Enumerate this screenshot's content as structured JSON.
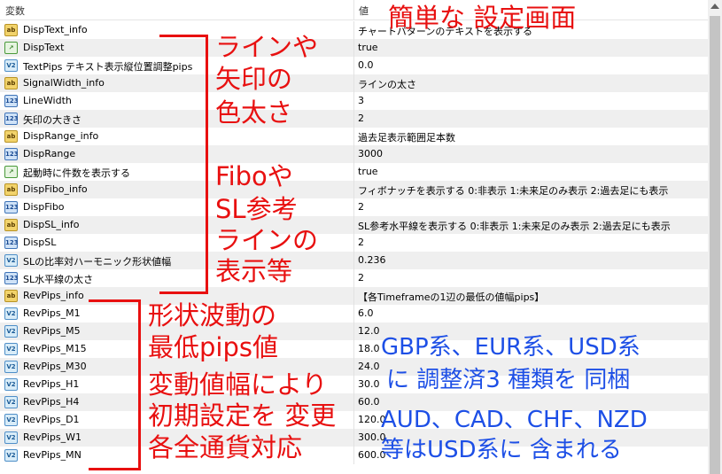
{
  "header": {
    "col_name": "変数",
    "col_value": "値"
  },
  "rows": [
    {
      "icon": "ab",
      "name": "DispText_info",
      "value": "チャートパターンのテキストを表示する"
    },
    {
      "icon": "bool",
      "name": "DispText",
      "value": "true"
    },
    {
      "icon": "v2",
      "name": "TextPips テキスト表示縦位置調整pips",
      "value": "0.0"
    },
    {
      "icon": "ab",
      "name": "SignalWidth_info",
      "value": "ラインの太さ"
    },
    {
      "icon": "n123",
      "name": "LineWidth",
      "value": "3"
    },
    {
      "icon": "n123",
      "name": "矢印の大きさ",
      "value": "2"
    },
    {
      "icon": "ab",
      "name": "DispRange_info",
      "value": "過去足表示範囲足本数"
    },
    {
      "icon": "n123",
      "name": "DispRange",
      "value": "3000"
    },
    {
      "icon": "bool",
      "name": "起動時に件数を表示する",
      "value": "true"
    },
    {
      "icon": "ab",
      "name": "DispFibo_info",
      "value": "フィボナッチを表示する 0:非表示 1:未来足のみ表示 2:過去足にも表示"
    },
    {
      "icon": "n123",
      "name": "DispFibo",
      "value": "2"
    },
    {
      "icon": "ab",
      "name": "DispSL_info",
      "value": "SL参考水平線を表示する 0:非表示 1:未来足のみ表示 2:過去足にも表示"
    },
    {
      "icon": "n123",
      "name": "DispSL",
      "value": "2"
    },
    {
      "icon": "v2",
      "name": "SLの比率対ハーモニック形状値幅",
      "value": "0.236"
    },
    {
      "icon": "n123",
      "name": "SL水平線の太さ",
      "value": "2"
    },
    {
      "icon": "ab",
      "name": "RevPips_info",
      "value": "【各Timeframeの1辺の最低の値幅pips】"
    },
    {
      "icon": "v2",
      "name": "RevPips_M1",
      "value": "6.0"
    },
    {
      "icon": "v2",
      "name": "RevPips_M5",
      "value": "12.0"
    },
    {
      "icon": "v2",
      "name": "RevPips_M15",
      "value": "18.0"
    },
    {
      "icon": "v2",
      "name": "RevPips_M30",
      "value": "24.0"
    },
    {
      "icon": "v2",
      "name": "RevPips_H1",
      "value": "30.0"
    },
    {
      "icon": "v2",
      "name": "RevPips_H4",
      "value": "60.0"
    },
    {
      "icon": "v2",
      "name": "RevPips_D1",
      "value": "120.0"
    },
    {
      "icon": "v2",
      "name": "RevPips_W1",
      "value": "300.0"
    },
    {
      "icon": "v2",
      "name": "RevPips_MN",
      "value": "600.0"
    }
  ],
  "annotations": {
    "title": "簡単な 設定画面",
    "group1": [
      "ラインや",
      "矢印の",
      "色太さ"
    ],
    "group2": [
      "Fiboや",
      "SL参考",
      "ラインの",
      "表示等"
    ],
    "group3": [
      "形状波動の",
      "最低pips値",
      "変動値幅により",
      "初期設定を 変更",
      "各全通貨対応"
    ],
    "blue": [
      "GBP系、EUR系、USD系",
      "に 調整済3 種類を 同梱",
      "AUD、CAD、CHF、NZD",
      "等はUSD系に 含まれる"
    ]
  }
}
